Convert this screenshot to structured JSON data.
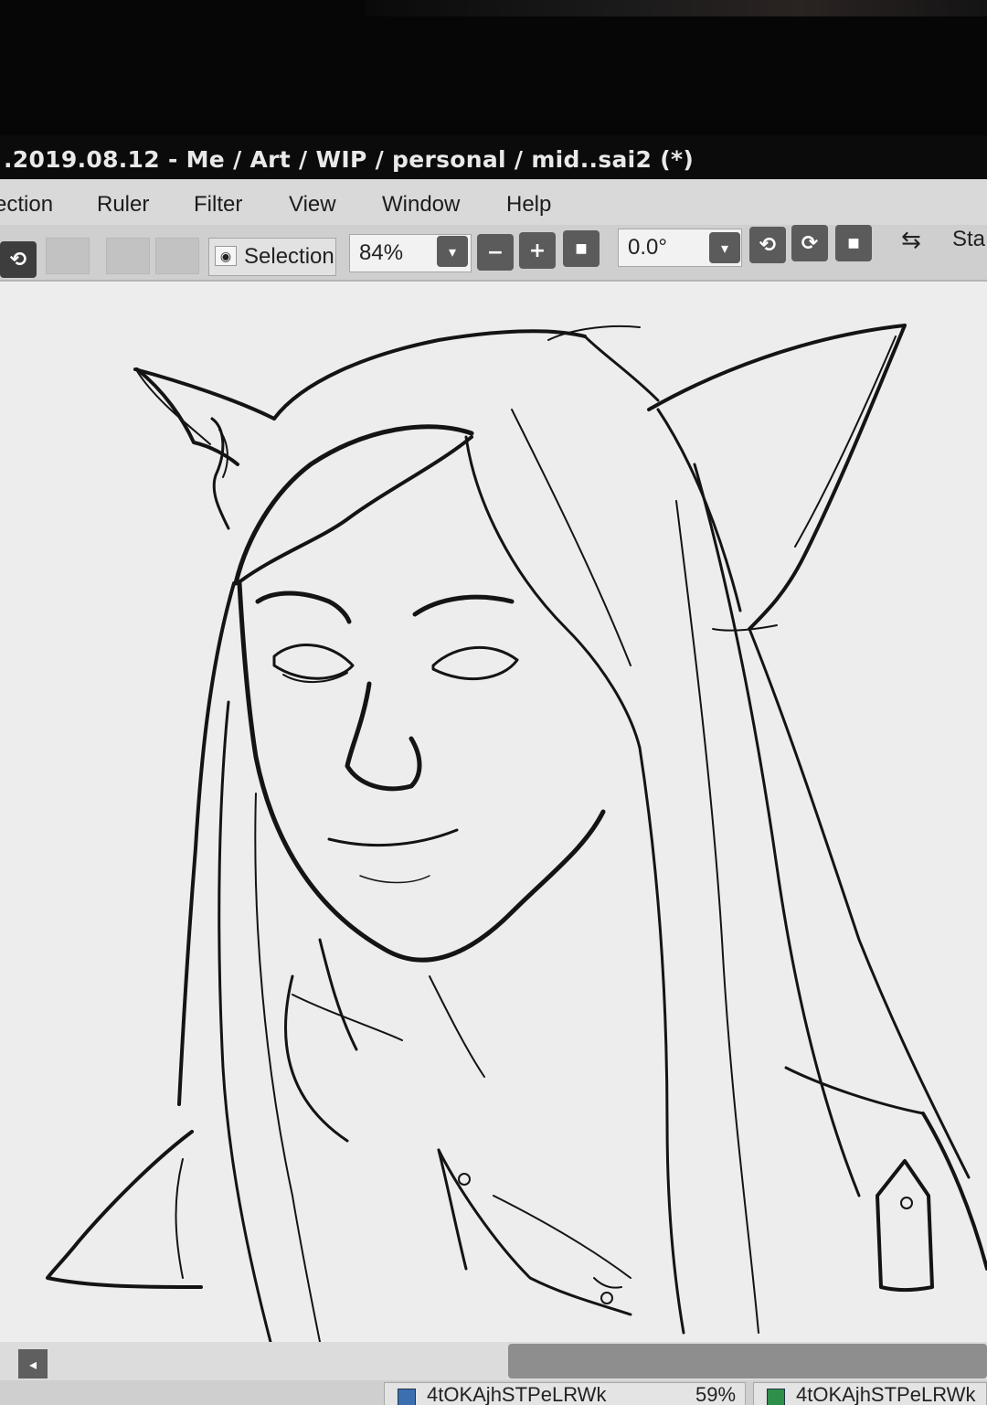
{
  "window": {
    "title": ".2019.08.12 - Me / Art / WIP / personal / mid..sai2 (*)"
  },
  "menu": {
    "items": [
      "ection",
      "Ruler",
      "Filter",
      "View",
      "Window",
      "Help"
    ]
  },
  "toolbar": {
    "undo_icon": "undo-icon",
    "selection_label": "Selection",
    "zoom_value": "84%",
    "rotation_value": "0.0°",
    "stab_label": "Sta",
    "swap_icon": "swap-arrows-icon"
  },
  "taskbar": {
    "tab1_label": "4tOKAjhSTPeLRWk",
    "tab1_zoom": "59%",
    "tab2_label": "4tOKAjhSTPeLRWk"
  }
}
